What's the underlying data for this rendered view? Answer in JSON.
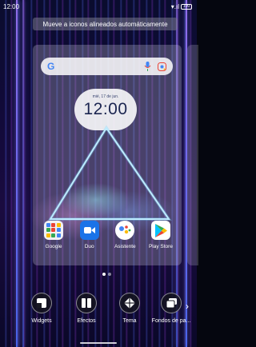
{
  "status_bar": {
    "time": "12:00",
    "signal": "▾.ıl",
    "battery": "100"
  },
  "hint": "Mueve a iconos alineados automáticamente",
  "search": {
    "logo": "G",
    "icons": [
      "mic-icon",
      "lens-icon"
    ]
  },
  "clock": {
    "date": "mié, 17 de jun.",
    "time": "12:00"
  },
  "apps": [
    {
      "label": "Google",
      "icon": "google-folder-icon"
    },
    {
      "label": "Duo",
      "icon": "duo-icon"
    },
    {
      "label": "Asistente",
      "icon": "assistant-icon"
    },
    {
      "label": "Play Store",
      "icon": "play-store-icon"
    }
  ],
  "page_indicator": {
    "count": 2,
    "active": 0
  },
  "options": [
    {
      "label": "Widgets",
      "icon": "widgets-icon"
    },
    {
      "label": "Efectos",
      "icon": "effects-icon"
    },
    {
      "label": "Tema",
      "icon": "theme-icon"
    },
    {
      "label": "Fondos de pa...",
      "icon": "wallpapers-icon"
    }
  ],
  "colors": {
    "duo_blue": "#1a73e8",
    "clock_text": "#1b2550"
  }
}
